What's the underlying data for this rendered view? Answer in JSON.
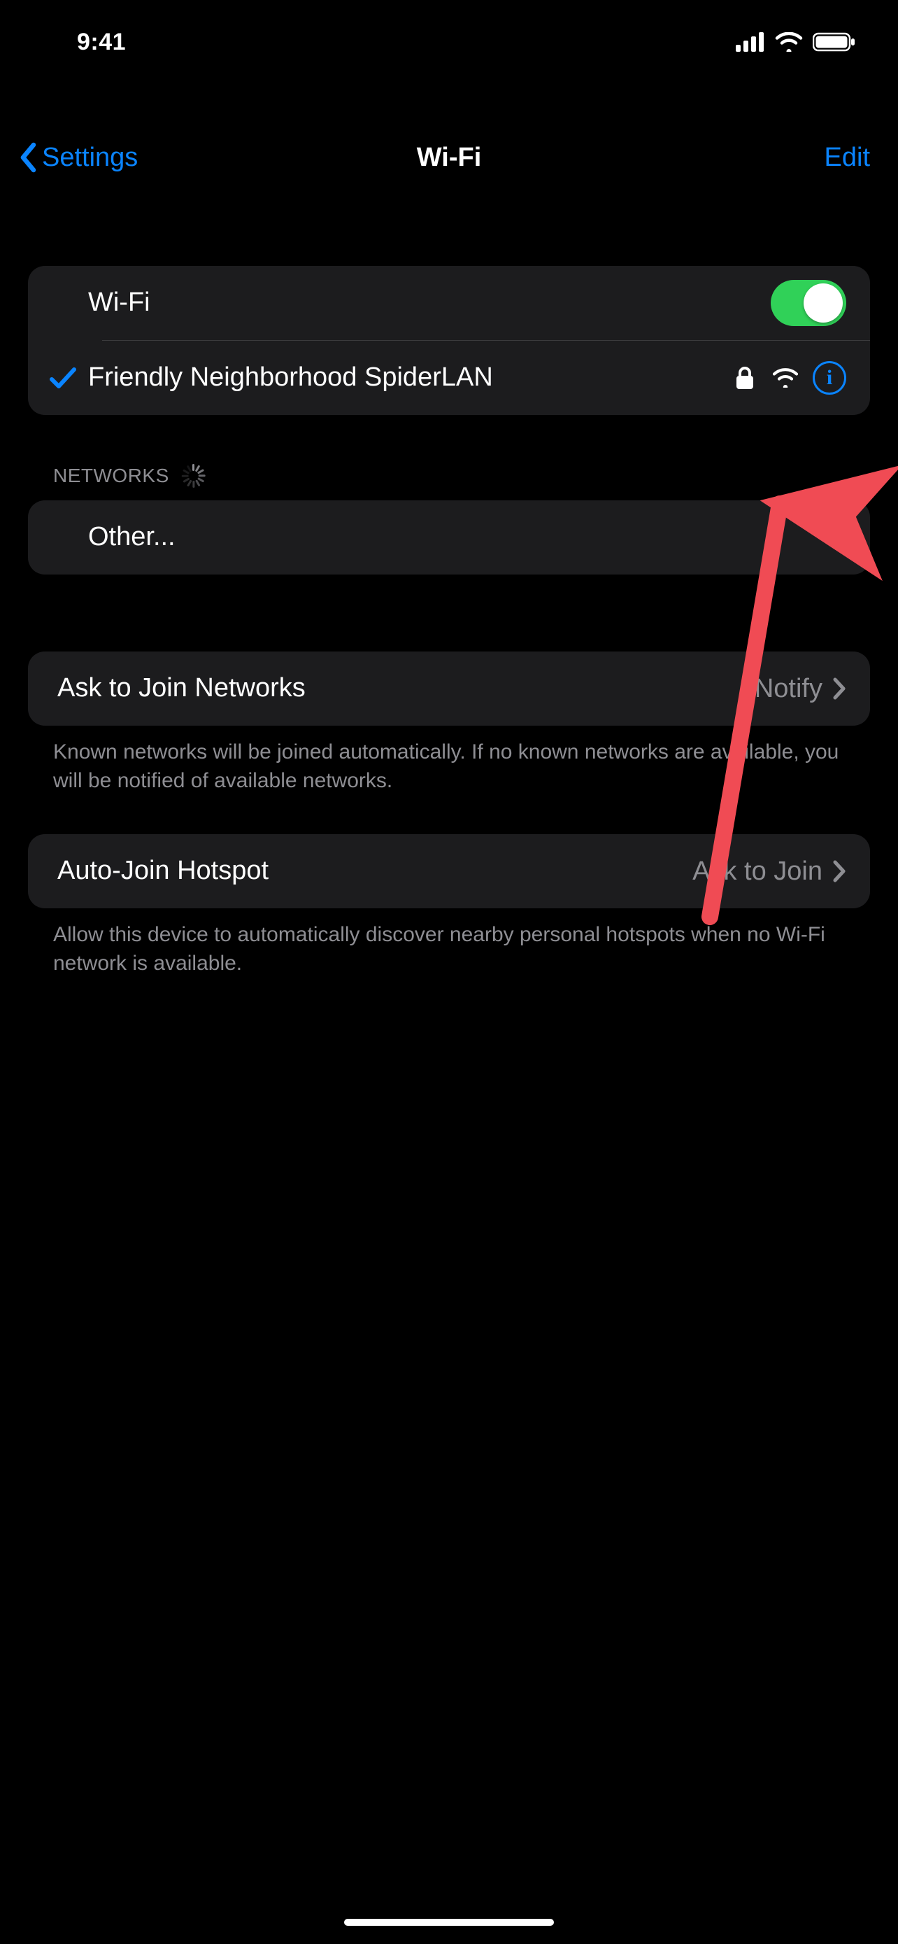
{
  "statusbar": {
    "time": "9:41"
  },
  "nav": {
    "back_label": "Settings",
    "title": "Wi-Fi",
    "edit_label": "Edit"
  },
  "wifi": {
    "row_label": "Wi-Fi",
    "enabled": true,
    "connected_network": "Friendly Neighborhood SpiderLAN",
    "connected_secure": true
  },
  "networks": {
    "header": "Networks",
    "other_label": "Other..."
  },
  "ask_to_join": {
    "label": "Ask to Join Networks",
    "value": "Notify",
    "footer": "Known networks will be joined automatically. If no known networks are available, you will be notified of available networks."
  },
  "auto_join_hotspot": {
    "label": "Auto-Join Hotspot",
    "value": "Ask to Join",
    "footer": "Allow this device to automatically discover nearby personal hotspots when no Wi-Fi network is available."
  },
  "annotation": {
    "arrow_color": "#f04b54",
    "target": "network-info-button"
  },
  "colors": {
    "accent": "#0a84ff",
    "toggle_on": "#30d158",
    "bg_group": "#1c1c1e",
    "text_secondary": "#8e8e93"
  }
}
